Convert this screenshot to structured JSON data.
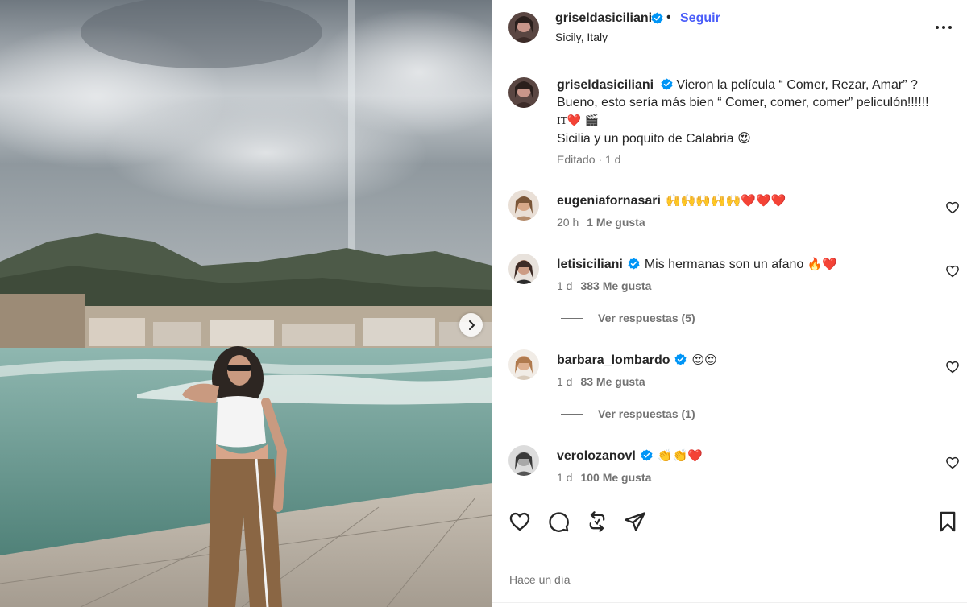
{
  "post": {
    "author": "griseldasiciliani",
    "follow_label": "Seguir",
    "separator": "•",
    "location": "Sicily, Italy",
    "verified": true,
    "more_icon": "more-horizontal-icon"
  },
  "caption": {
    "username": "griseldasiciliani",
    "line1": "Vieron la película “ Comer, Rezar, Amar” ?",
    "line2": "Bueno, esto sería más bien “ Comer, comer, comer” peliculón!!!!!!",
    "line3_prefix": "IT",
    "line3_emoji": "❤️ 🎬",
    "line4": "Sicilia y un poquito de Calabria",
    "line4_emoji": "😍",
    "edited": "Editado",
    "meta_sep": "·",
    "age": "1 d"
  },
  "comments": [
    {
      "username": "eugeniafornasari",
      "verified": false,
      "text": "",
      "emoji": "🙌🙌🙌🙌🙌❤️❤️❤️",
      "age": "20 h",
      "likes": "1 Me gusta"
    },
    {
      "username": "letisiciliani",
      "verified": true,
      "text": "Mis hermanas son un afano",
      "emoji": "🔥❤️",
      "age": "1 d",
      "likes": "383 Me gusta"
    },
    {
      "username": "barbara_lombardo",
      "verified": true,
      "text": "",
      "emoji": "😍😍",
      "age": "1 d",
      "likes": "83 Me gusta"
    },
    {
      "username": "verolozanovl",
      "verified": true,
      "text": "",
      "emoji": "👏👏❤️",
      "age": "1 d",
      "likes": "100 Me gusta"
    }
  ],
  "replies": [
    {
      "label": "Ver respuestas (5)"
    },
    {
      "label": "Ver respuestas (1)"
    }
  ],
  "actions": {
    "icons": [
      "heart-icon",
      "comment-icon",
      "share-icon",
      "send-icon",
      "bookmark-icon"
    ],
    "timestamp": "Hace un día"
  },
  "colors": {
    "accent": "#4a5df9",
    "verified": "#0095f6",
    "text": "#262626",
    "muted": "#737373"
  }
}
